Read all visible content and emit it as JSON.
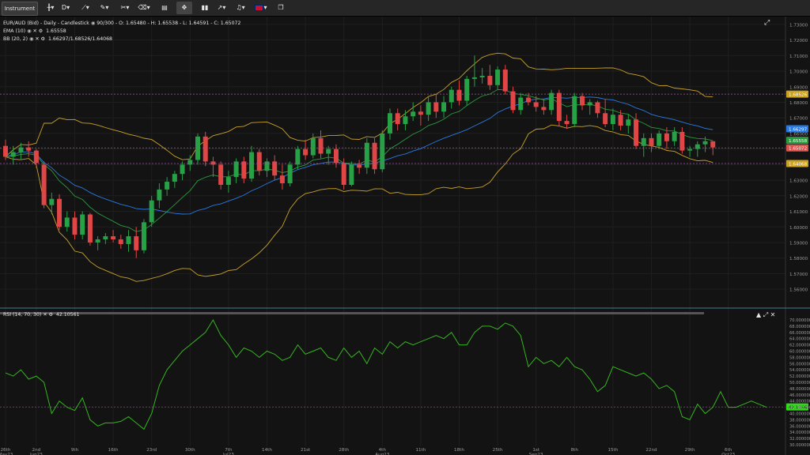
{
  "toolbar": {
    "instrument_label": "Instrument",
    "period_label": "D",
    "items": [
      {
        "name": "candle-type-icon",
        "glyph": "╫"
      },
      {
        "name": "line-draw-icon",
        "glyph": "⟋"
      },
      {
        "name": "pencil-icon",
        "glyph": "✎"
      },
      {
        "name": "tools-icon",
        "glyph": "✂"
      },
      {
        "name": "trash-icon",
        "glyph": "🗑"
      },
      {
        "name": "layout-icon",
        "glyph": "▤"
      },
      {
        "name": "crosshair-icon",
        "glyph": "✥"
      },
      {
        "name": "indicators-icon",
        "glyph": "▮▮"
      },
      {
        "name": "share-icon",
        "glyph": "↗"
      },
      {
        "name": "alert-icon",
        "glyph": "🔔"
      },
      {
        "name": "language-flag-icon",
        "glyph": "🇬🇧"
      },
      {
        "name": "popout-icon",
        "glyph": "❐"
      }
    ],
    "colors": {
      "bg": "#262626",
      "active": "#444444"
    }
  },
  "legend": {
    "instrument": "EUR/AUD (Bid) - Daily - Candlestick",
    "ohlc": "90/300 - O: 1.65480 - H: 1.65538 - L: 1.64591 - C: 1.65072",
    "ema_label": "EMA (10)",
    "ema_value": "1.65558",
    "bb_label": "BB (20, 2)",
    "bb_value": "1.66297/1.68526/1.64068",
    "rsi_label": "RSI (14, 70, 30)",
    "rsi_value": "42.10561"
  },
  "chart_data": [
    {
      "type": "candlestick",
      "ylim": [
        1.555,
        1.735
      ],
      "y_ticks": [
        "1.73000",
        "1.72000",
        "1.71000",
        "1.70000",
        "1.69000",
        "1.68000",
        "1.67000",
        "1.66000",
        "1.65000",
        "1.64000",
        "1.63000",
        "1.62000",
        "1.61000",
        "1.60000",
        "1.59000",
        "1.58000",
        "1.57000",
        "1.56000"
      ],
      "price_tags": [
        {
          "value": 1.68526,
          "label": "1.68526",
          "color": "#c9a227"
        },
        {
          "value": 1.66297,
          "label": "1.66297",
          "color": "#2a7ae2"
        },
        {
          "value": 1.65558,
          "label": "1.65558",
          "color": "#2a9a3f"
        },
        {
          "value": 1.65072,
          "label": "1.65072",
          "color": "#d9534f"
        },
        {
          "value": 1.64068,
          "label": "1.64068",
          "color": "#c9a227"
        }
      ],
      "x_labels": [
        {
          "i": 0,
          "top": "26th",
          "bottom": "May23"
        },
        {
          "i": 4,
          "top": "2nd",
          "bottom": "Jun23"
        },
        {
          "i": 9,
          "top": "9th",
          "bottom": ""
        },
        {
          "i": 14,
          "top": "16th",
          "bottom": ""
        },
        {
          "i": 19,
          "top": "23rd",
          "bottom": ""
        },
        {
          "i": 24,
          "top": "30th",
          "bottom": ""
        },
        {
          "i": 29,
          "top": "7th",
          "bottom": "Jul23"
        },
        {
          "i": 34,
          "top": "14th",
          "bottom": ""
        },
        {
          "i": 39,
          "top": "21st",
          "bottom": ""
        },
        {
          "i": 44,
          "top": "28th",
          "bottom": ""
        },
        {
          "i": 49,
          "top": "4th",
          "bottom": "Aug23"
        },
        {
          "i": 54,
          "top": "11th",
          "bottom": ""
        },
        {
          "i": 59,
          "top": "18th",
          "bottom": ""
        },
        {
          "i": 64,
          "top": "25th",
          "bottom": ""
        },
        {
          "i": 69,
          "top": "1st",
          "bottom": "Sep23"
        },
        {
          "i": 74,
          "top": "8th",
          "bottom": ""
        },
        {
          "i": 79,
          "top": "15th",
          "bottom": ""
        },
        {
          "i": 84,
          "top": "22nd",
          "bottom": ""
        },
        {
          "i": 89,
          "top": "29th",
          "bottom": ""
        },
        {
          "i": 94,
          "top": "6th",
          "bottom": "Oct23"
        }
      ],
      "candles": [
        [
          1.652,
          1.656,
          1.643,
          1.645
        ],
        [
          1.645,
          1.652,
          1.64,
          1.648
        ],
        [
          1.648,
          1.654,
          1.643,
          1.651
        ],
        [
          1.651,
          1.655,
          1.645,
          1.649
        ],
        [
          1.649,
          1.65,
          1.638,
          1.641
        ],
        [
          1.64,
          1.642,
          1.612,
          1.614
        ],
        [
          1.614,
          1.622,
          1.608,
          1.618
        ],
        [
          1.618,
          1.621,
          1.598,
          1.6
        ],
        [
          1.6,
          1.61,
          1.597,
          1.606
        ],
        [
          1.606,
          1.61,
          1.592,
          1.595
        ],
        [
          1.595,
          1.61,
          1.592,
          1.608
        ],
        [
          1.608,
          1.609,
          1.588,
          1.59
        ],
        [
          1.59,
          1.594,
          1.585,
          1.592
        ],
        [
          1.592,
          1.596,
          1.589,
          1.594
        ],
        [
          1.594,
          1.598,
          1.59,
          1.592
        ],
        [
          1.592,
          1.595,
          1.586,
          1.589
        ],
        [
          1.589,
          1.598,
          1.584,
          1.594
        ],
        [
          1.594,
          1.6,
          1.58,
          1.585
        ],
        [
          1.585,
          1.605,
          1.583,
          1.603
        ],
        [
          1.603,
          1.62,
          1.6,
          1.617
        ],
        [
          1.617,
          1.628,
          1.612,
          1.624
        ],
        [
          1.624,
          1.632,
          1.62,
          1.629
        ],
        [
          1.629,
          1.636,
          1.625,
          1.634
        ],
        [
          1.634,
          1.642,
          1.63,
          1.64
        ],
        [
          1.64,
          1.646,
          1.636,
          1.643
        ],
        [
          1.643,
          1.66,
          1.64,
          1.658
        ],
        [
          1.658,
          1.661,
          1.639,
          1.642
        ],
        [
          1.642,
          1.645,
          1.632,
          1.64
        ],
        [
          1.64,
          1.642,
          1.624,
          1.627
        ],
        [
          1.627,
          1.636,
          1.622,
          1.632
        ],
        [
          1.632,
          1.644,
          1.628,
          1.642
        ],
        [
          1.642,
          1.645,
          1.628,
          1.631
        ],
        [
          1.631,
          1.652,
          1.629,
          1.648
        ],
        [
          1.648,
          1.65,
          1.633,
          1.636
        ],
        [
          1.636,
          1.644,
          1.632,
          1.642
        ],
        [
          1.642,
          1.646,
          1.63,
          1.633
        ],
        [
          1.633,
          1.64,
          1.624,
          1.628
        ],
        [
          1.628,
          1.642,
          1.626,
          1.64
        ],
        [
          1.64,
          1.652,
          1.637,
          1.65
        ],
        [
          1.65,
          1.656,
          1.643,
          1.646
        ],
        [
          1.646,
          1.66,
          1.644,
          1.657
        ],
        [
          1.657,
          1.662,
          1.644,
          1.647
        ],
        [
          1.647,
          1.652,
          1.64,
          1.65
        ],
        [
          1.65,
          1.653,
          1.638,
          1.641
        ],
        [
          1.641,
          1.644,
          1.624,
          1.627
        ],
        [
          1.627,
          1.642,
          1.626,
          1.64
        ],
        [
          1.64,
          1.643,
          1.634,
          1.638
        ],
        [
          1.638,
          1.657,
          1.634,
          1.654
        ],
        [
          1.654,
          1.657,
          1.634,
          1.637
        ],
        [
          1.637,
          1.662,
          1.635,
          1.66
        ],
        [
          1.66,
          1.676,
          1.656,
          1.673
        ],
        [
          1.673,
          1.676,
          1.662,
          1.666
        ],
        [
          1.666,
          1.675,
          1.662,
          1.671
        ],
        [
          1.671,
          1.68,
          1.668,
          1.674
        ],
        [
          1.674,
          1.678,
          1.665,
          1.672
        ],
        [
          1.672,
          1.684,
          1.668,
          1.68
        ],
        [
          1.68,
          1.685,
          1.67,
          1.674
        ],
        [
          1.674,
          1.684,
          1.67,
          1.68
        ],
        [
          1.68,
          1.69,
          1.676,
          1.688
        ],
        [
          1.688,
          1.694,
          1.678,
          1.681
        ],
        [
          1.681,
          1.697,
          1.678,
          1.695
        ],
        [
          1.695,
          1.71,
          1.69,
          1.696
        ],
        [
          1.696,
          1.702,
          1.692,
          1.697
        ],
        [
          1.697,
          1.704,
          1.688,
          1.691
        ],
        [
          1.691,
          1.703,
          1.688,
          1.701
        ],
        [
          1.701,
          1.704,
          1.685,
          1.687
        ],
        [
          1.687,
          1.69,
          1.673,
          1.675
        ],
        [
          1.675,
          1.686,
          1.672,
          1.683
        ],
        [
          1.683,
          1.686,
          1.678,
          1.68
        ],
        [
          1.68,
          1.684,
          1.674,
          1.677
        ],
        [
          1.677,
          1.682,
          1.672,
          1.675
        ],
        [
          1.675,
          1.688,
          1.672,
          1.686
        ],
        [
          1.686,
          1.688,
          1.665,
          1.668
        ],
        [
          1.668,
          1.672,
          1.663,
          1.666
        ],
        [
          1.666,
          1.686,
          1.664,
          1.684
        ],
        [
          1.684,
          1.686,
          1.675,
          1.678
        ],
        [
          1.678,
          1.682,
          1.672,
          1.68
        ],
        [
          1.68,
          1.681,
          1.67,
          1.673
        ],
        [
          1.673,
          1.682,
          1.664,
          1.666
        ],
        [
          1.666,
          1.676,
          1.662,
          1.672
        ],
        [
          1.672,
          1.675,
          1.662,
          1.665
        ],
        [
          1.665,
          1.672,
          1.66,
          1.669
        ],
        [
          1.669,
          1.673,
          1.65,
          1.652
        ],
        [
          1.652,
          1.66,
          1.645,
          1.657
        ],
        [
          1.657,
          1.66,
          1.648,
          1.652
        ],
        [
          1.652,
          1.662,
          1.65,
          1.66
        ],
        [
          1.66,
          1.664,
          1.65,
          1.655
        ],
        [
          1.655,
          1.664,
          1.652,
          1.661
        ],
        [
          1.661,
          1.664,
          1.647,
          1.649
        ],
        [
          1.649,
          1.652,
          1.645,
          1.65
        ],
        [
          1.65,
          1.655,
          1.645,
          1.653
        ],
        [
          1.653,
          1.658,
          1.648,
          1.655
        ],
        [
          1.655,
          1.655,
          1.646,
          1.651
        ]
      ]
    },
    {
      "type": "line",
      "name": "RSI",
      "ylim": [
        29.5,
        71
      ],
      "y_ticks": [
        "70.000000",
        "68.000000",
        "66.000000",
        "64.000000",
        "62.000000",
        "60.000000",
        "58.000000",
        "56.000000",
        "54.000000",
        "52.000000",
        "50.000000",
        "48.000000",
        "46.000000",
        "44.000000",
        "42.000000",
        "40.000000",
        "38.000000",
        "36.000000",
        "34.000000",
        "32.000000",
        "30.000000"
      ],
      "level_line": 42.10561,
      "current_label": "42.10561",
      "values": [
        53,
        52,
        54,
        51,
        52,
        50,
        40,
        44,
        42,
        41,
        45,
        38,
        36,
        37,
        37,
        37.5,
        39,
        37,
        35,
        40,
        49,
        54,
        57,
        60,
        62,
        64,
        66,
        70,
        65,
        62,
        58,
        61,
        60,
        58,
        60,
        59,
        57,
        58,
        62,
        59,
        60,
        61,
        58,
        57,
        61,
        58,
        60,
        56,
        61,
        59,
        63,
        61,
        63,
        62,
        63,
        64,
        65,
        64,
        66,
        62,
        62,
        66,
        68,
        68,
        67,
        69,
        68,
        65,
        55,
        58,
        56,
        57,
        55,
        58,
        55,
        54,
        51,
        47,
        49,
        55,
        54,
        53,
        52,
        53,
        51,
        48,
        49,
        47,
        39,
        38,
        43,
        40,
        42,
        47,
        42,
        42,
        43,
        44,
        43,
        42
      ]
    }
  ]
}
